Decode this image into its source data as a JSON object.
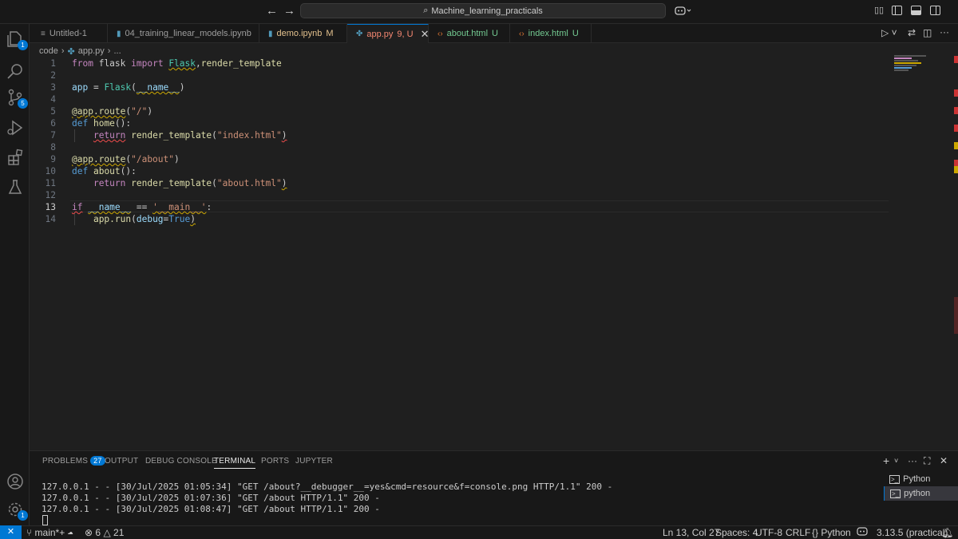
{
  "title_bar": {
    "search_text": "Machine_learning_practicals"
  },
  "tabs": [
    {
      "label": "Untitled-1",
      "icon": "menu-icon"
    },
    {
      "label": "04_training_linear_models.ipynb",
      "icon": "notebook-icon",
      "dirty": true
    },
    {
      "label": "demo.ipynb",
      "status": "M",
      "icon": "notebook-icon"
    },
    {
      "label": "app.py",
      "status": "9, U",
      "icon": "python-icon",
      "active": true
    },
    {
      "label": "about.html",
      "status": "U",
      "icon": "html-icon"
    },
    {
      "label": "index.html",
      "status": "U",
      "icon": "html-icon"
    }
  ],
  "breadcrumb": {
    "folder": "code",
    "file": "app.py",
    "symbol": "..."
  },
  "editor": {
    "current_line": 13,
    "line_numbers": [
      "1",
      "2",
      "3",
      "4",
      "5",
      "6",
      "7",
      "8",
      "9",
      "10",
      "11",
      "12",
      "13",
      "14"
    ],
    "tokens": {
      "from": "from",
      "flask": "flask",
      "import": "import",
      "Flask": "Flask",
      "comma": ",",
      "render_template": "render_template",
      "app": "app",
      "eq": " = ",
      "name_arg": "__name__",
      "lp": "(",
      "rp": ")",
      "at_app_route": "@app.route",
      "route_root": "\"/\"",
      "def": "def",
      "home": "home",
      "parens_colon": "():",
      "return": "return",
      "index_html": "\"index.html\"",
      "route_about": "\"/about\"",
      "about": "about",
      "about_html": "\"about.html\"",
      "if": "if",
      "dunder_name": "__name__",
      "eqeq": " == ",
      "main_str": "'__main__'",
      "colon": ":",
      "app_run": "app.run",
      "debug": "debug",
      "assign": "=",
      "true": "True"
    }
  },
  "panel": {
    "tabs": [
      "PROBLEMS",
      "OUTPUT",
      "DEBUG CONSOLE",
      "TERMINAL",
      "PORTS",
      "JUPYTER"
    ],
    "problems_count": "27",
    "active_tab": "TERMINAL",
    "terminal_lines": [
      "127.0.0.1 - - [30/Jul/2025 01:05:34] \"GET /about?__debugger__=yes&cmd=resource&f=console.png HTTP/1.1\" 200 -",
      "127.0.0.1 - - [30/Jul/2025 01:07:36] \"GET /about HTTP/1.1\" 200 -",
      "127.0.0.1 - - [30/Jul/2025 01:08:47] \"GET /about HTTP/1.1\" 200 -"
    ],
    "sessions": [
      "Python",
      "python"
    ]
  },
  "activity_badges": {
    "explorer": "1",
    "source_control": "5",
    "manage": "1"
  },
  "status_bar": {
    "branch": "main*+",
    "errors": "6",
    "warnings": "21",
    "position": "Ln 13, Col 27",
    "spaces": "Spaces: 4",
    "encoding": "UTF-8",
    "eol": "CRLF",
    "language": "Python",
    "interpreter": "3.13.5 (practical)"
  },
  "colors": {
    "accent": "#0078d4",
    "error": "#f14c4c",
    "warning": "#cca700",
    "untracked": "#73c991"
  }
}
